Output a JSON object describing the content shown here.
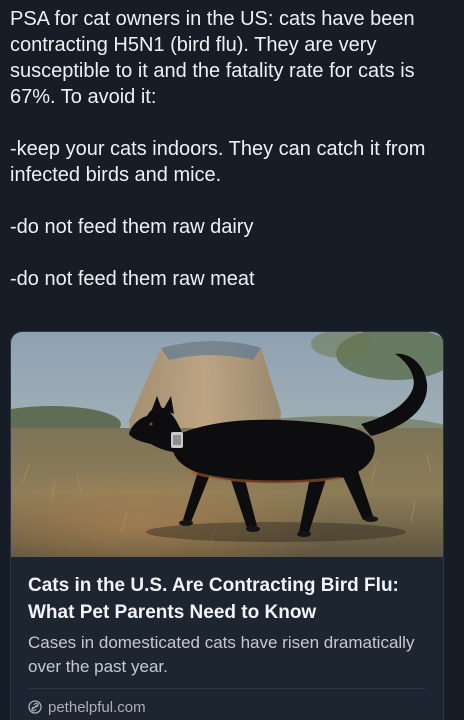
{
  "post": {
    "paragraphs": [
      "PSA for cat owners in the US: cats have been contracting H5N1 (bird flu). They are very susceptible to it and the fatality rate for cats is 67%. To avoid it:",
      "-keep your cats indoors. They can catch it from infected birds and mice.",
      "-do not feed them raw dairy",
      "-do not feed them raw meat"
    ]
  },
  "link_card": {
    "title": "Cats in the U.S. Are Contracting Bird Flu: What Pet Parents Need to Know",
    "description": "Cases in domesticated cats have risen dramatically over the past year.",
    "domain": "pethelpful.com",
    "domain_icon": "link-icon",
    "image_subject": "black-cat-walking-photo"
  },
  "colors": {
    "background": "#161d27",
    "card_background": "#1d2531",
    "text_primary": "#eef1f4",
    "text_secondary": "#c4cad3"
  }
}
